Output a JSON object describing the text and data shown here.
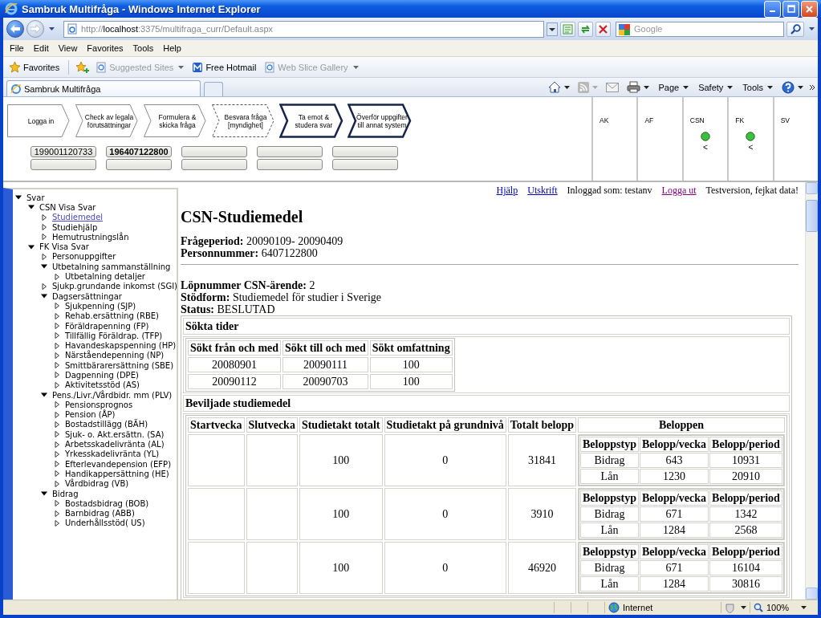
{
  "window": {
    "title": "Sambruk Multifråga - Windows Internet Explorer"
  },
  "address_bar": {
    "url": "http://**localhost**:3375/multifraga_curr/Default.aspx"
  },
  "search_box": {
    "placeholder": "Google"
  },
  "menu_bar": [
    "File",
    "Edit",
    "View",
    "Favorites",
    "Tools",
    "Help"
  ],
  "favorites_bar": {
    "favorites": "Favorites",
    "items": [
      {
        "label": "Suggested Sites",
        "disabled": true,
        "kind": "feed"
      },
      {
        "label": "Free Hotmail",
        "disabled": false,
        "kind": "link"
      },
      {
        "label": "Web Slice Gallery",
        "disabled": true,
        "kind": "feed"
      }
    ]
  },
  "tabs": [
    {
      "label": "Sambruk Multifråga",
      "selected": true
    }
  ],
  "command_bar": [
    "Page",
    "Safety",
    "Tools"
  ],
  "process": {
    "steps": [
      {
        "label": "Logga in",
        "kind": "done"
      },
      {
        "label": "Check av legala\nförutsättningar",
        "kind": "done"
      },
      {
        "label": "Formulera &\nskicka fråga",
        "kind": "done"
      },
      {
        "label": "Besvara fråga\n[myndighet]",
        "kind": "external"
      },
      {
        "label": "Ta emot &\nstudera svar",
        "kind": "current"
      },
      {
        "label": "Överför uppgifter\ntill annat system",
        "kind": "current"
      }
    ],
    "person_fields": [
      {
        "value": "199001120733",
        "selected": false
      },
      {
        "value": "196407122800",
        "selected": true
      }
    ]
  },
  "agencies": [
    {
      "label": "AK",
      "answered": false
    },
    {
      "label": "AF",
      "answered": false
    },
    {
      "label": "CSN",
      "answered": true,
      "marker": "<"
    },
    {
      "label": "FK",
      "answered": true,
      "marker": "<"
    },
    {
      "label": "SV",
      "answered": false
    }
  ],
  "tree": [
    {
      "label": "Svar",
      "expanded": true,
      "selected": false,
      "children": [
        {
          "label": "CSN Visa Svar",
          "expanded": true,
          "selected": false,
          "children": [
            {
              "label": "Studiemedel",
              "expanded": false,
              "selected": true
            },
            {
              "label": "Studiehjälp",
              "expanded": false,
              "selected": false
            },
            {
              "label": "Hemutrustningslån",
              "expanded": false,
              "selected": false
            }
          ]
        },
        {
          "label": "FK Visa Svar",
          "expanded": true,
          "selected": false,
          "children": [
            {
              "label": "Personuppgifter",
              "expanded": false,
              "selected": false
            },
            {
              "label": "Utbetalning sammanställning",
              "expanded": true,
              "selected": false,
              "children": [
                {
                  "label": "Utbetalning detaljer",
                  "expanded": false,
                  "selected": false
                }
              ]
            },
            {
              "label": "Sjukp.grundande inkomst (SGI)",
              "expanded": false,
              "selected": false
            },
            {
              "label": "Dagsersättningar",
              "expanded": true,
              "selected": false,
              "children": [
                {
                  "label": "Sjukpenning (SJP)",
                  "expanded": false,
                  "selected": false
                },
                {
                  "label": "Rehab.ersättning (RBE)",
                  "expanded": false,
                  "selected": false
                },
                {
                  "label": "Föräldrapenning (FP)",
                  "expanded": false,
                  "selected": false
                },
                {
                  "label": "Tillfällig Föräldrap. (TFP)",
                  "expanded": false,
                  "selected": false
                },
                {
                  "label": "Havandeskapspenning (HP)",
                  "expanded": false,
                  "selected": false
                },
                {
                  "label": "Närståendepenning (NP)",
                  "expanded": false,
                  "selected": false
                },
                {
                  "label": "Smittbärarersättning (SBE)",
                  "expanded": false,
                  "selected": false
                },
                {
                  "label": "Dagpenning (DPE)",
                  "expanded": false,
                  "selected": false
                },
                {
                  "label": "Aktivitetsstöd (AS)",
                  "expanded": false,
                  "selected": false
                }
              ]
            },
            {
              "label": "Pens./Livr./Vårdbidr. mm (PLV)",
              "expanded": true,
              "selected": false,
              "children": [
                {
                  "label": "Pensionsprognos",
                  "expanded": false,
                  "selected": false
                },
                {
                  "label": "Pension (ÅP)",
                  "expanded": false,
                  "selected": false
                },
                {
                  "label": "Bostadstillägg (BÄH)",
                  "expanded": false,
                  "selected": false
                },
                {
                  "label": "Sjuk- o. Akt.ersättn. (SA)",
                  "expanded": false,
                  "selected": false
                },
                {
                  "label": "Arbetsskadelivränta (AL)",
                  "expanded": false,
                  "selected": false
                },
                {
                  "label": "Yrkesskadelivränta (YL)",
                  "expanded": false,
                  "selected": false
                },
                {
                  "label": "Efterlevandepension (EFP)",
                  "expanded": false,
                  "selected": false
                },
                {
                  "label": "Handikappersättning (HE)",
                  "expanded": false,
                  "selected": false
                },
                {
                  "label": "Vårdbidrag (VB)",
                  "expanded": false,
                  "selected": false
                }
              ]
            },
            {
              "label": "Bidrag",
              "expanded": true,
              "selected": false,
              "children": [
                {
                  "label": "Bostadsbidrag (BOB)",
                  "expanded": false,
                  "selected": false
                },
                {
                  "label": "Barnbidrag (ABB)",
                  "expanded": false,
                  "selected": false
                },
                {
                  "label": "Underhållsstöd( US)",
                  "expanded": false,
                  "selected": false
                }
              ]
            }
          ]
        }
      ]
    }
  ],
  "top_links": [
    {
      "label": "Hjälp",
      "kind": "link"
    },
    {
      "label": "Utskrift",
      "kind": "link"
    },
    {
      "label": "Inloggad som: testanv",
      "kind": "text"
    },
    {
      "label": "Logga ut",
      "kind": "visited"
    },
    {
      "label": "Testversion, fejkat data!",
      "kind": "text"
    }
  ],
  "heading": "CSN-Studiemedel",
  "query_info": [
    "**Frågeperiod:** 20090109- 20090409",
    "**Personnummer:** 6407122800"
  ],
  "case_info": [
    "**Löpnummer CSN-ärende:** 2",
    "**Stödform:** Studiemedel för studier i Sverige",
    "**Status:** BESLUTAD"
  ],
  "requested_periods": {
    "title": "Sökta tider",
    "columns": [
      "Sökt från och med",
      "Sökt till och med",
      "Sökt omfattning"
    ],
    "rows": [
      [
        "20080901",
        "20090111",
        "100"
      ],
      [
        "20090112",
        "20090703",
        "100"
      ]
    ]
  },
  "granted": {
    "title": "Beviljade studiemedel",
    "columns": [
      "Startvecka",
      "Slutvecka",
      "Studietakt totalt",
      "Studietakt på grundnivå",
      "Totalt belopp",
      "Beloppen"
    ],
    "rows": [
      {
        "studietakt_totalt": "100",
        "studietakt_grundniva": "0",
        "totalt_belopp": "31841",
        "beloppen": {
          "columns": [
            "Beloppstyp",
            "Belopp/vecka",
            "Belopp/period"
          ],
          "rows": [
            [
              "Bidrag",
              "643",
              "10931"
            ],
            [
              "Lån",
              "1230",
              "20910"
            ]
          ]
        }
      },
      {
        "studietakt_totalt": "100",
        "studietakt_grundniva": "0",
        "totalt_belopp": "3910",
        "beloppen": {
          "columns": [
            "Beloppstyp",
            "Belopp/vecka",
            "Belopp/period"
          ],
          "rows": [
            [
              "Bidrag",
              "671",
              "1342"
            ],
            [
              "Lån",
              "1284",
              "2568"
            ]
          ]
        }
      },
      {
        "studietakt_totalt": "100",
        "studietakt_grundniva": "0",
        "totalt_belopp": "46920",
        "beloppen": {
          "columns": [
            "Beloppstyp",
            "Belopp/vecka",
            "Belopp/period"
          ],
          "rows": [
            [
              "Bidrag",
              "671",
              "16104"
            ],
            [
              "Lån",
              "1284",
              "30816"
            ]
          ]
        }
      }
    ]
  },
  "status_bar": {
    "zone": "Internet",
    "zoom": "100%"
  }
}
